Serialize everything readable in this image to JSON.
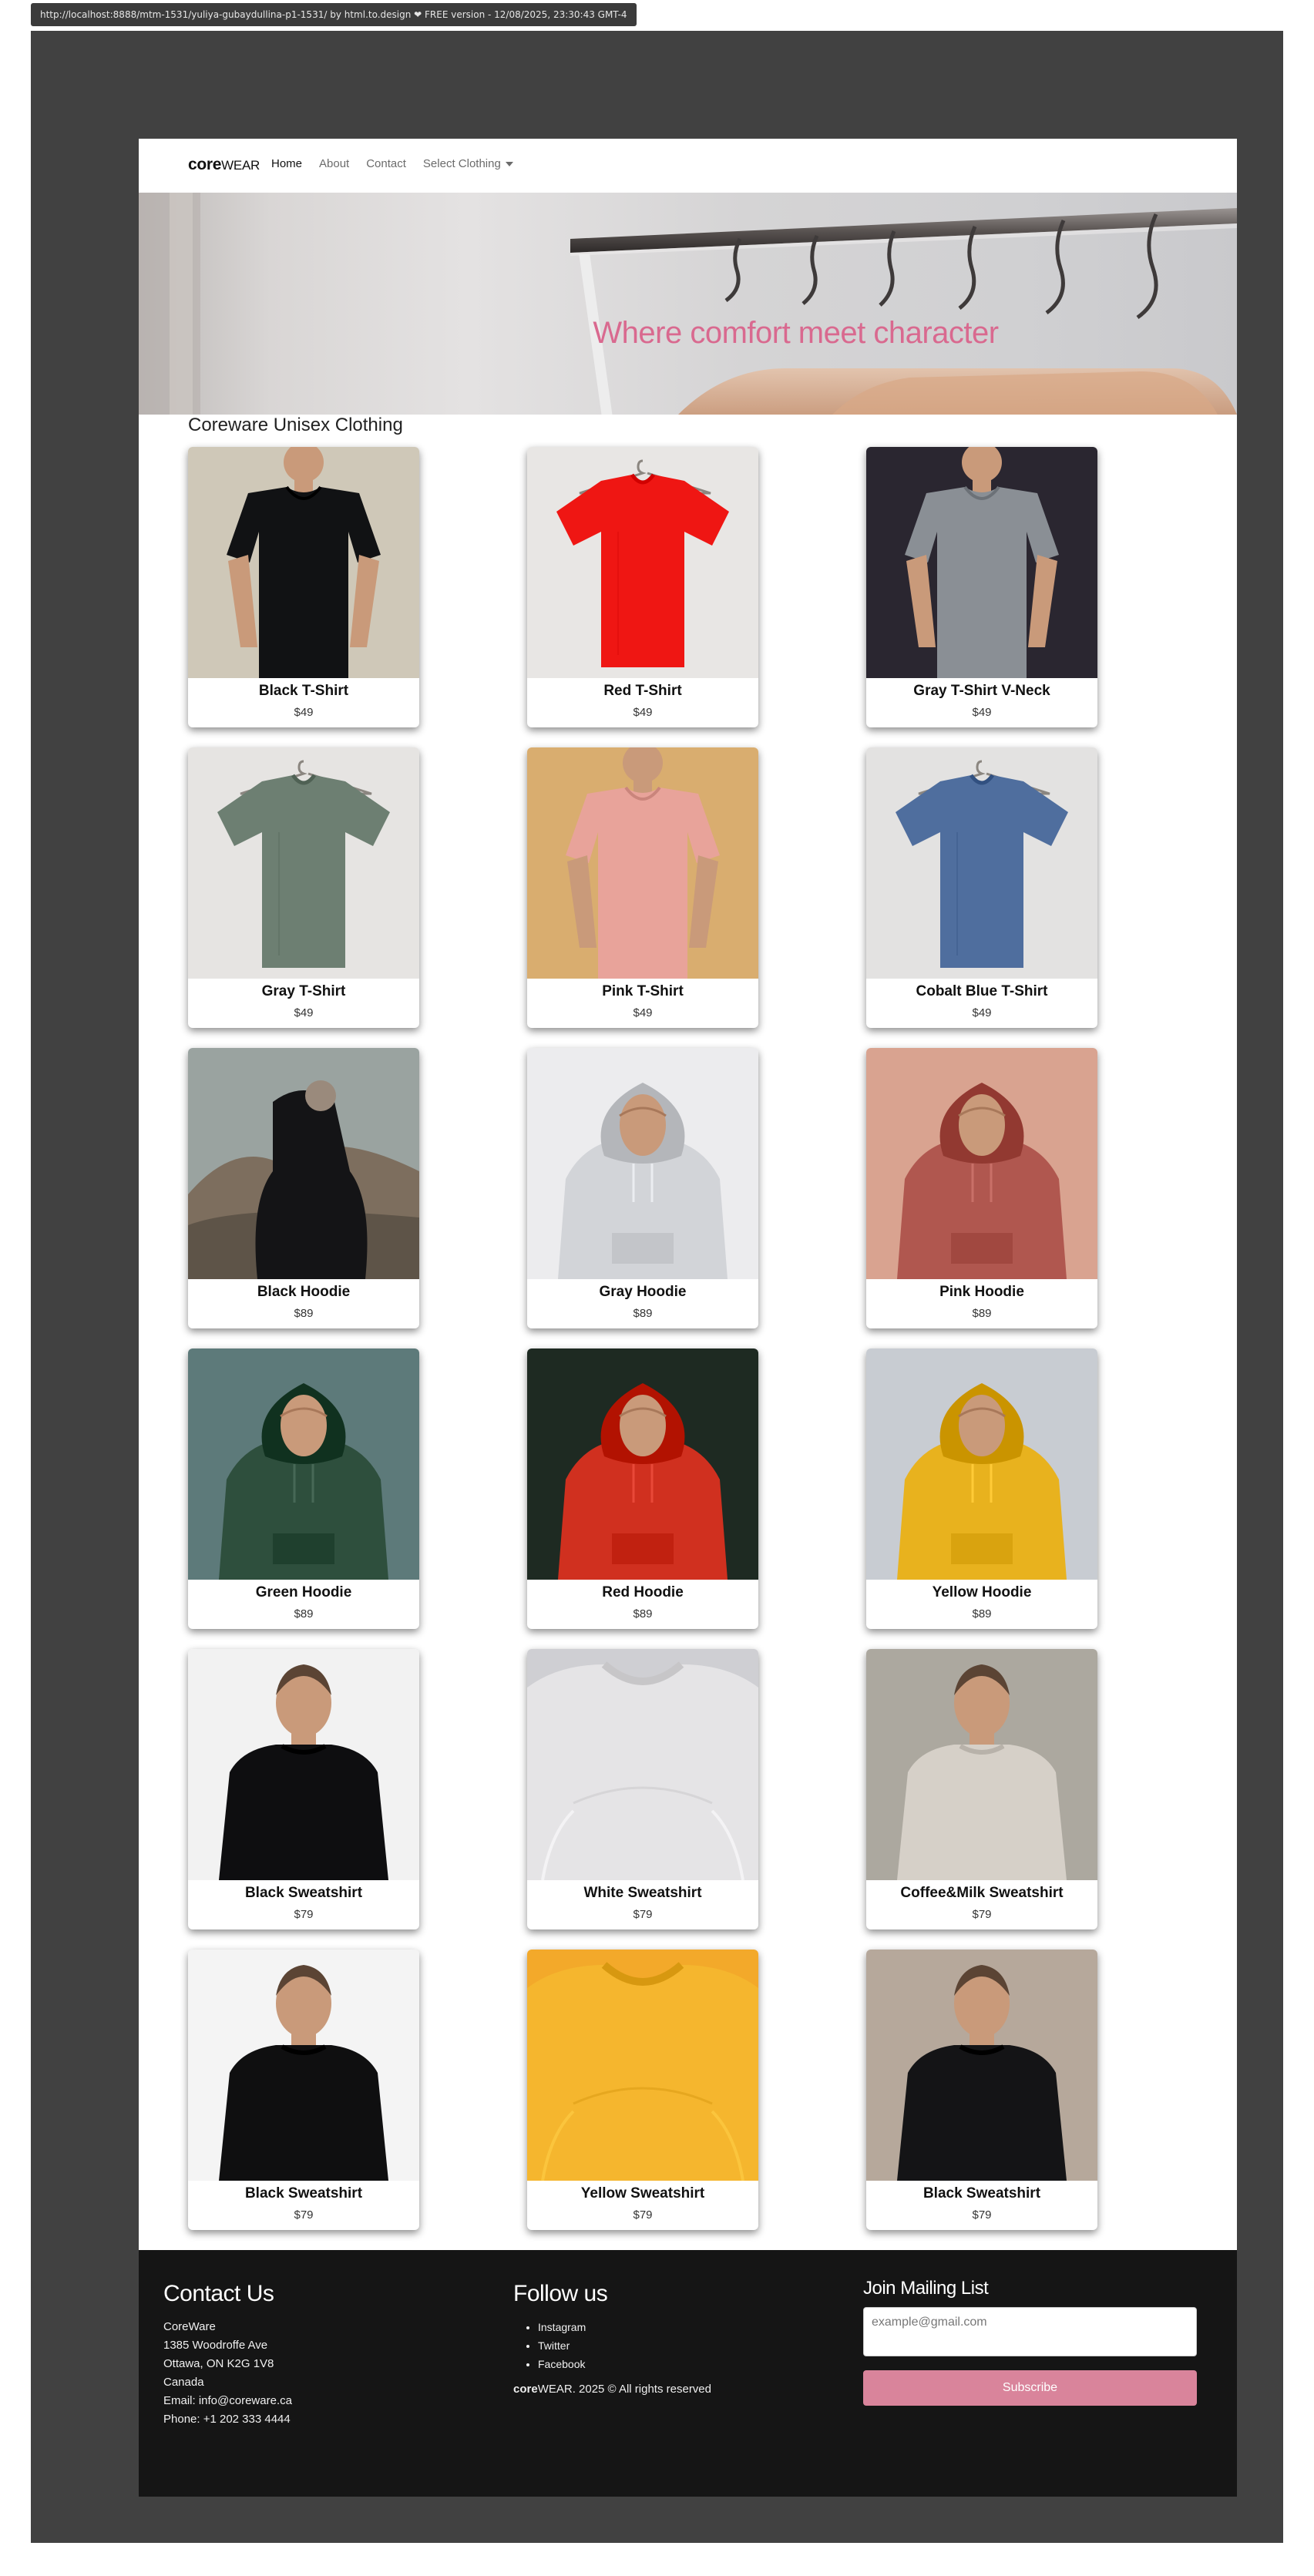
{
  "browser": {
    "status_text": "http://localhost:8888/mtm-1531/yuliya-gubaydullina-p1-1531/ by html.to.design ❤ FREE version - 12/08/2025, 23:30:43 GMT-4"
  },
  "nav": {
    "brand_bold": "core",
    "brand_rest": "WEAR",
    "links": [
      "Home",
      "About",
      "Contact",
      "Select Clothing"
    ]
  },
  "hero": {
    "tagline": "Where comfort meet character"
  },
  "section": {
    "title": "Coreware Unisex Clothing"
  },
  "products": [
    {
      "name": "Black T-Shirt",
      "price": "$49",
      "color": "#111214",
      "bg": "#cfc8b8",
      "style": "tee-person"
    },
    {
      "name": "Red T-Shirt",
      "price": "$49",
      "color": "#ef1613",
      "bg": "#e8e6e4",
      "style": "tee-hanger"
    },
    {
      "name": "Gray T-Shirt V-Neck",
      "price": "$49",
      "color": "#8a8f95",
      "bg": "#2a2630",
      "style": "tee-person"
    },
    {
      "name": "Gray T-Shirt",
      "price": "$49",
      "color": "#6d7f72",
      "bg": "#e6e4e2",
      "style": "tee-hanger"
    },
    {
      "name": "Pink T-Shirt",
      "price": "$49",
      "color": "#e8a39a",
      "bg": "#d9ad6f",
      "style": "tee-person"
    },
    {
      "name": "Cobalt Blue T-Shirt",
      "price": "$49",
      "color": "#4f6e9e",
      "bg": "#e3e2e1",
      "style": "tee-hanger"
    },
    {
      "name": "Black Hoodie",
      "price": "$89",
      "color": "#141416",
      "bg": "#9aa3a0",
      "style": "hoodie-back"
    },
    {
      "name": "Gray Hoodie",
      "price": "$89",
      "color": "#d2d4d8",
      "bg": "#ececee",
      "style": "hoodie-front"
    },
    {
      "name": "Pink Hoodie",
      "price": "$89",
      "color": "#b0574f",
      "bg": "#d9a390",
      "style": "hoodie-front"
    },
    {
      "name": "Green Hoodie",
      "price": "$89",
      "color": "#2e4f3d",
      "bg": "#5d7a7a",
      "style": "hoodie-front"
    },
    {
      "name": "Red Hoodie",
      "price": "$89",
      "color": "#d0301f",
      "bg": "#1e2a22",
      "style": "hoodie-front"
    },
    {
      "name": "Yellow Hoodie",
      "price": "$89",
      "color": "#e8b21e",
      "bg": "#c8ccd2",
      "style": "hoodie-front"
    },
    {
      "name": "Black Sweatshirt",
      "price": "$79",
      "color": "#0e0e10",
      "bg": "#f2f2f2",
      "style": "sweat-person"
    },
    {
      "name": "White Sweatshirt",
      "price": "$79",
      "color": "#e5e4e6",
      "bg": "#cfcfd3",
      "style": "sweat-close"
    },
    {
      "name": "Coffee&Milk Sweatshirt",
      "price": "$79",
      "color": "#d6d0c8",
      "bg": "#aca89f",
      "style": "sweat-person"
    },
    {
      "name": "Black Sweatshirt",
      "price": "$79",
      "color": "#0f0f10",
      "bg": "#f4f4f4",
      "style": "sweat-person"
    },
    {
      "name": "Yellow Sweatshirt",
      "price": "$79",
      "color": "#f5b62e",
      "bg": "#f3a92a",
      "style": "sweat-close"
    },
    {
      "name": "Black Sweatshirt",
      "price": "$79",
      "color": "#141416",
      "bg": "#b6a89b",
      "style": "sweat-person"
    }
  ],
  "footer": {
    "contact_title": "Contact Us",
    "contact_lines": [
      "CoreWare",
      "1385 Woodroffe Ave",
      "Ottawa, ON K2G 1V8",
      "Canada",
      "Email: info@coreware.ca",
      "Phone: +1 202 333 4444"
    ],
    "follow_title": "Follow us",
    "social": [
      "Instagram",
      "Twitter",
      "Facebook"
    ],
    "copyright_bold": "core",
    "copyright_rest": "WEAR. 2025 © All rights reserved",
    "mailing_title": "Join Mailing List",
    "email_placeholder": "example@gmail.com",
    "subscribe_label": "Subscribe"
  }
}
